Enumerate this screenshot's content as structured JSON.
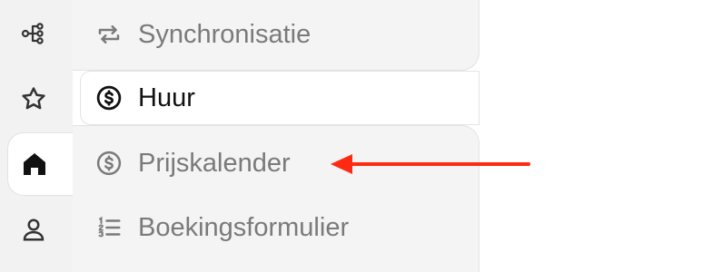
{
  "rail": {
    "items": [
      {
        "icon": "flow-icon",
        "active": false
      },
      {
        "icon": "star-icon",
        "active": false
      },
      {
        "icon": "home-icon",
        "active": true
      },
      {
        "icon": "user-icon",
        "active": false
      }
    ]
  },
  "submenu": {
    "items": [
      {
        "label": "Synchronisatie",
        "icon": "sync-icon",
        "active": false
      },
      {
        "label": "Huur",
        "icon": "dollar-circle-icon",
        "active": true
      },
      {
        "label": "Prijskalender",
        "icon": "dollar-circle-icon",
        "active": false
      },
      {
        "label": "Boekingsformulier",
        "icon": "numbered-list-icon",
        "active": false
      }
    ]
  },
  "annotation": {
    "icon": "arrow-left-icon",
    "color": "#ff2a12"
  },
  "colors": {
    "inactive_text": "#7a7a7a",
    "active_text": "#111111",
    "panel_bg": "#f4f4f4"
  }
}
